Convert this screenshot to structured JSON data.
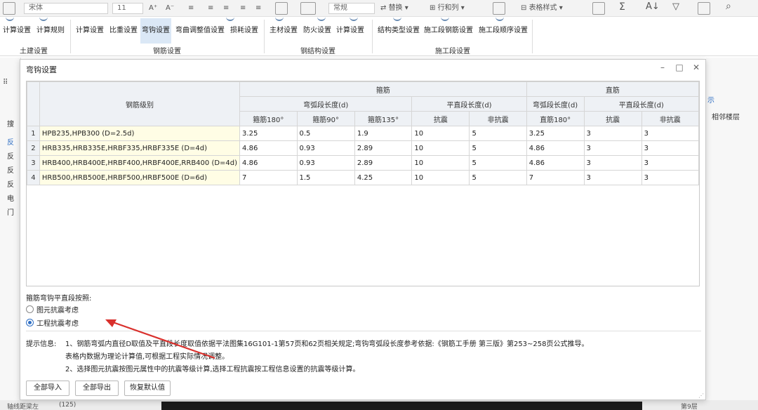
{
  "toolbar": {
    "font": "宋体",
    "font_size": "11",
    "style": "常规",
    "replace": "替换",
    "row_col": "行和列",
    "table_style": "表格样式"
  },
  "ribbon": {
    "buttons": [
      "计算设置",
      "计算规则",
      "计算设置",
      "比重设置",
      "弯钩设置",
      "弯曲调整值设置",
      "损耗设置",
      "主材设置",
      "防火设置",
      "计算设置",
      "结构类型设置",
      "施工段钢筋设置",
      "施工段顺序设置"
    ],
    "groups": [
      "土建设置",
      "钢筋设置",
      "钢结构设置",
      "施工段设置"
    ]
  },
  "background": {
    "left_labels": [
      "搜",
      "反",
      "反",
      "反",
      "反",
      "电",
      "门"
    ],
    "right_tab": "示",
    "right_label": "相邻楼层",
    "bottom_left": "轴线距梁左",
    "bottom_count": "(125)",
    "bottom_right": "第9层"
  },
  "dialog": {
    "title": "弯钩设置",
    "header": {
      "grade_col": "钢筋级别",
      "stirrup": "箍筋",
      "straight": "直筋",
      "hook_len": "弯弧段长度(d)",
      "flat_len": "平直段长度(d)",
      "st180": "箍筋180°",
      "st90": "箍筋90°",
      "st135": "箍筋135°",
      "seismic": "抗震",
      "non_seismic": "非抗震",
      "str_hook_len": "弯弧段长度(d)",
      "str180": "直筋180°",
      "str_flat_len": "平直段长度(d)",
      "str_seismic": "抗震",
      "str_non_seismic": "非抗震"
    },
    "rows": [
      {
        "num": "1",
        "grade": "HPB235,HPB300 (D=2.5d)",
        "v": [
          "3.25",
          "0.5",
          "1.9",
          "10",
          "5",
          "3.25",
          "3",
          "3"
        ]
      },
      {
        "num": "2",
        "grade": "HRB335,HRB335E,HRBF335,HRBF335E (D=4d)",
        "v": [
          "4.86",
          "0.93",
          "2.89",
          "10",
          "5",
          "4.86",
          "3",
          "3"
        ]
      },
      {
        "num": "3",
        "grade": "HRB400,HRB400E,HRBF400,HRBF400E,RRB400 (D=4d)",
        "v": [
          "4.86",
          "0.93",
          "2.89",
          "10",
          "5",
          "4.86",
          "3",
          "3"
        ]
      },
      {
        "num": "4",
        "grade": "HRB500,HRB500E,HRBF500,HRBF500E (D=6d)",
        "v": [
          "7",
          "1.5",
          "4.25",
          "10",
          "5",
          "7",
          "3",
          "3"
        ]
      }
    ],
    "option_label": "箍筋弯钩平直段按照:",
    "options": [
      {
        "label": "图元抗震考虑",
        "checked": false
      },
      {
        "label": "工程抗震考虑",
        "checked": true
      }
    ],
    "hint_label": "提示信息:",
    "hints": [
      "1、钢筋弯弧内直径D取值及平直段长度取值依据平法图集16G101-1第57页和62页相关规定;弯钩弯弧段长度参考依据:《钢筋工手册 第三版》第253~258页公式推导。",
      "表格内数据为理论计算值,可根据工程实际情况调整。",
      "2、选择图元抗震按图元属性中的抗震等级计算,选择工程抗震按工程信息设置的抗震等级计算。"
    ],
    "buttons": {
      "import": "全部导入",
      "export": "全部导出",
      "restore": "恢复默认值"
    }
  },
  "colors": {
    "grade_bg": "#fffde5",
    "header_bg": "#eef1f5",
    "arrow": "#d9302c",
    "active_ribbon": "#dbe8f6"
  }
}
